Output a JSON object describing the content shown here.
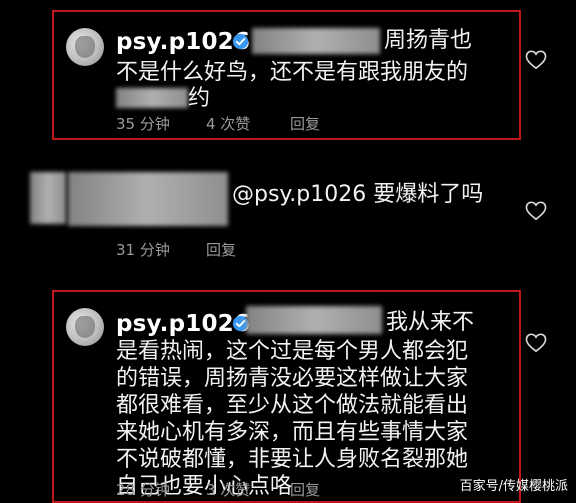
{
  "comments": [
    {
      "username": "psy.p1026",
      "lines": [
        "周扬青也",
        "不是什么好鸟，还不是有跟我朋友的",
        "约"
      ],
      "time": "35 分钟",
      "likes": "4 次赞",
      "reply": "回复"
    },
    {
      "mention_text": "@psy.p1026 要爆料了吗",
      "time": "31 分钟",
      "reply": "回复"
    },
    {
      "username": "psy.p1026",
      "lines": [
        "我从来不",
        "是看热闹，这个过是每个男人都会犯",
        "的错误，周扬青没必要这样做让大家",
        "都很难看，至少从这个做法就能看出",
        "来她心机有多深，而且有些事情大家",
        "不说破都懂，非要让人身败名裂那她",
        "自己也要小心点咯"
      ],
      "time": "28 分钟",
      "likes": "3 次赞",
      "reply": "回复"
    }
  ],
  "watermark": "百家号/传媒樱桃派",
  "colors": {
    "background": "#000000",
    "highlight": "#c01818",
    "verified": "#3897f0",
    "meta": "#9a9a9a"
  },
  "icons": [
    "verified-badge-icon",
    "heart-icon"
  ]
}
